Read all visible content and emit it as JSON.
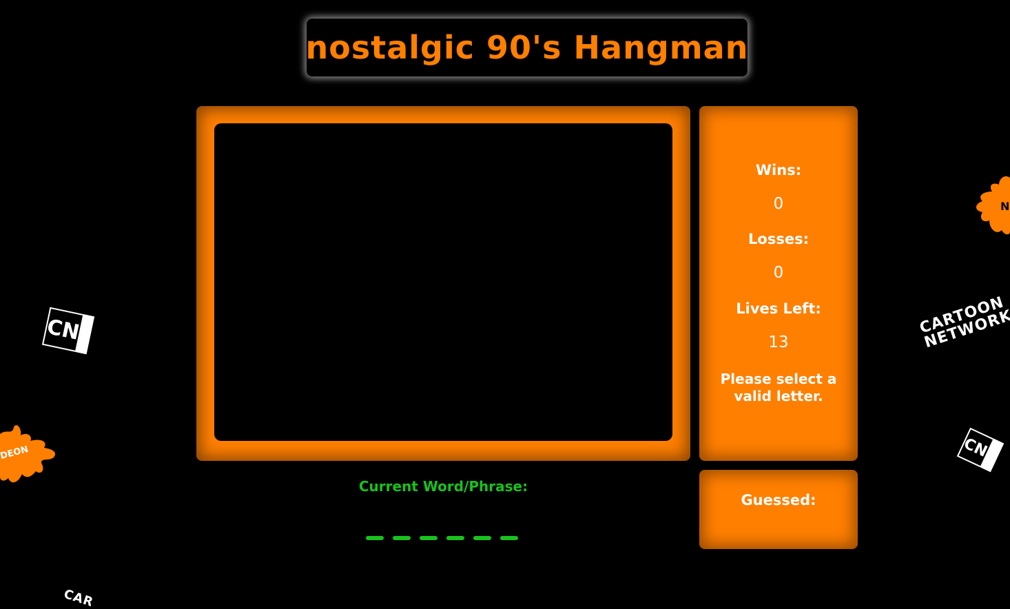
{
  "title": "nostalgic 90's Hangman",
  "stats": {
    "wins_label": "Wins:",
    "wins_value": "0",
    "losses_label": "Losses:",
    "losses_value": "0",
    "lives_label": "Lives Left:",
    "lives_value": "13",
    "message": "Please select a valid letter."
  },
  "guessed": {
    "label": "Guessed:",
    "letters": ""
  },
  "word": {
    "label": "Current Word/Phrase:",
    "blank_count": 6
  },
  "decor": {
    "cn_left": "CN",
    "cn_right": "CN",
    "cartoon_network_line1": "CARTOON",
    "cartoon_network_line2": "NETWORK",
    "cartoon_network_bottom": "CAR",
    "nick_left_text": "DEON",
    "nick_right_text": "N"
  },
  "colors": {
    "accent": "#ff7f00",
    "word": "#19c21d",
    "background": "#000000"
  }
}
